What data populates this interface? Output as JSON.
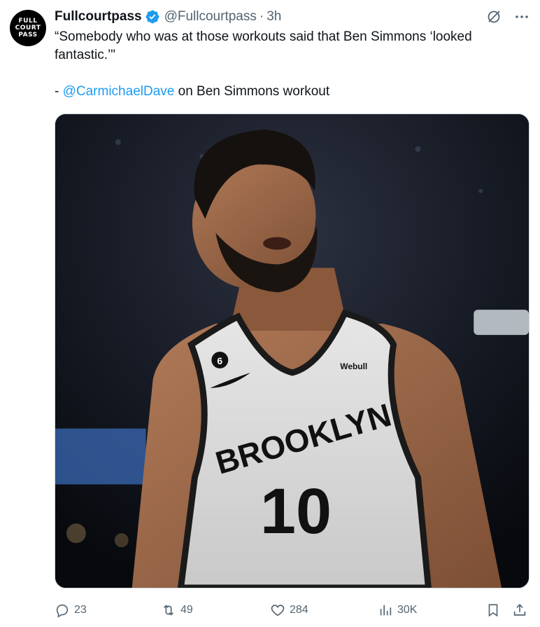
{
  "author": {
    "avatar_text": [
      "FULL",
      "COURT",
      "PASS"
    ],
    "name": "Fullcourtpass",
    "handle": "@Fullcourtpass",
    "separator": "·",
    "time": "3h",
    "verified_icon": "verified-badge-icon"
  },
  "tweet": {
    "line1": "“Somebody who was at those workouts said that Ben Simmons ‘looked fantastic.’\"",
    "attribution_prefix": "- ",
    "mention": "@CarmichaelDave",
    "attribution_suffix": " on Ben Simmons workout"
  },
  "media": {
    "jersey_text": "BROOKLYN",
    "jersey_number": "10",
    "patch_number": "6",
    "sponsor": "Webull"
  },
  "actions": {
    "replies": "23",
    "reposts": "49",
    "likes": "284",
    "views": "30K"
  },
  "colors": {
    "accent": "#1d9bf0",
    "text": "#0f1419",
    "muted": "#536471"
  }
}
